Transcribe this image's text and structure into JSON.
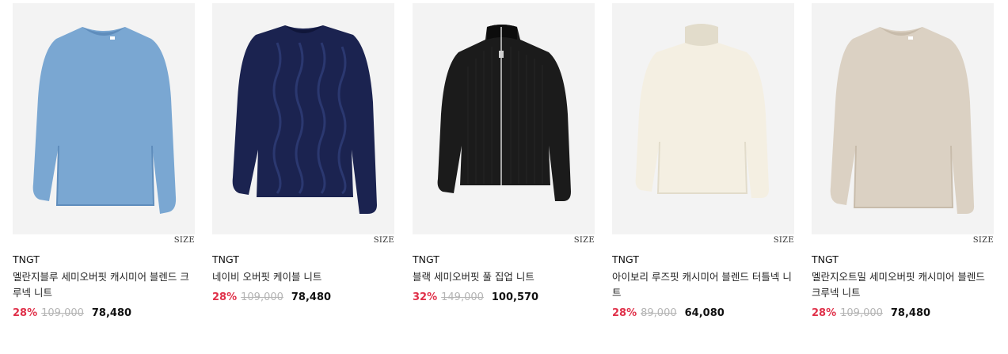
{
  "products": [
    {
      "brand": "TNGT",
      "name": "멜란지블루 세미오버핏 캐시미어 블렌드 크루넥 니트",
      "size_label": "SIZE",
      "discount": "28%",
      "original_price": "109,000",
      "final_price": "78,480",
      "image_icon": "blue-crewneck-sweater",
      "colors": {
        "body": "#7aa7d2",
        "shade": "#5f8dbc"
      }
    },
    {
      "brand": "TNGT",
      "name": "네이비 오버핏 케이블 니트",
      "size_label": "SIZE",
      "discount": "28%",
      "original_price": "109,000",
      "final_price": "78,480",
      "image_icon": "navy-cable-knit-sweater",
      "colors": {
        "body": "#1b2350",
        "shade": "#10163a"
      }
    },
    {
      "brand": "TNGT",
      "name": "블랙 세미오버핏 풀 집업 니트",
      "size_label": "SIZE",
      "discount": "32%",
      "original_price": "149,000",
      "final_price": "100,570",
      "image_icon": "black-zip-up-knit",
      "colors": {
        "body": "#1b1b1b",
        "shade": "#0c0c0c"
      }
    },
    {
      "brand": "TNGT",
      "name": "아이보리 루즈핏 캐시미어 블렌드 터틀넥 니트",
      "size_label": "SIZE",
      "discount": "28%",
      "original_price": "89,000",
      "final_price": "64,080",
      "image_icon": "ivory-turtleneck-sweater",
      "colors": {
        "body": "#f4efe2",
        "shade": "#e2dccb"
      }
    },
    {
      "brand": "TNGT",
      "name": "멜란지오트밀 세미오버핏 캐시미어 블렌드 크루넥 니트",
      "size_label": "SIZE",
      "discount": "28%",
      "original_price": "109,000",
      "final_price": "78,480",
      "image_icon": "oatmeal-crewneck-sweater",
      "colors": {
        "body": "#dbd1c3",
        "shade": "#c8bcab"
      }
    }
  ],
  "colors": {
    "discount": "#e0314a",
    "original_price": "#b4b4b4",
    "image_background": "#f3f3f3"
  }
}
